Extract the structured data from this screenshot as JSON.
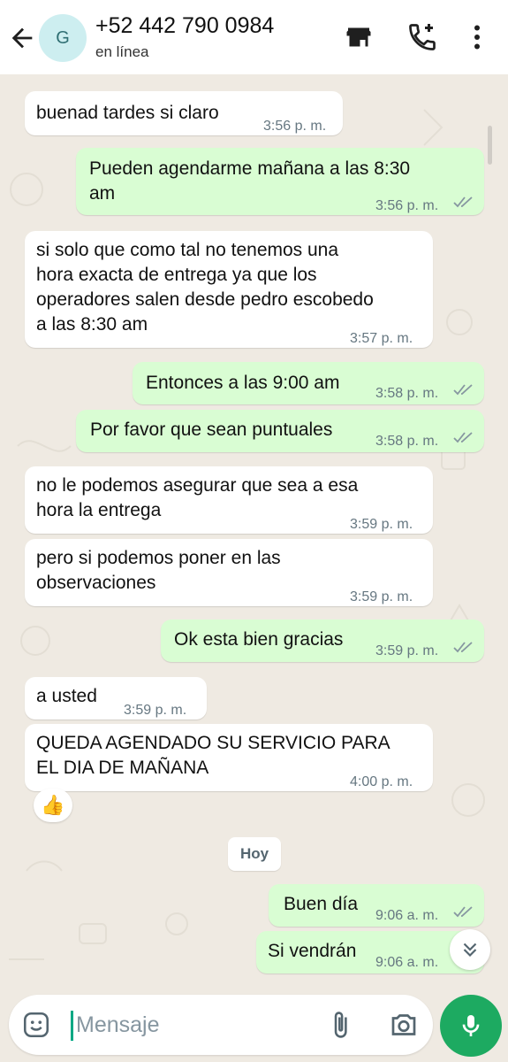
{
  "header": {
    "avatar_letter": "G",
    "title": "+52 442 790 0984",
    "subtitle": "en línea"
  },
  "icons": {
    "back": "arrow-left-icon",
    "store": "store-icon",
    "call": "add-call-icon",
    "menu": "more-vertical-icon",
    "emoji": "emoji-icon",
    "attach": "paperclip-icon",
    "camera": "camera-icon",
    "mic": "microphone-icon",
    "scroll": "chevron-double-down-icon"
  },
  "colors": {
    "background": "#efeae2",
    "incoming": "#ffffff",
    "outgoing": "#d9fdd3",
    "accent": "#1daa61",
    "tick": "#8696a0"
  },
  "messages": [
    {
      "dir": "in",
      "text": "buenad tardes si claro",
      "time": "3:56 p. m."
    },
    {
      "dir": "out",
      "text": "Pueden agendarme mañana a las 8:30\nam",
      "time": "3:56 p. m."
    },
    {
      "dir": "in",
      "text": "si solo que como tal no tenemos una\nhora exacta de entrega ya que los\noperadores salen desde pedro escobedo\na las 8:30 am",
      "time": "3:57 p. m."
    },
    {
      "dir": "out",
      "text": "Entonces a las 9:00 am",
      "time": "3:58 p. m."
    },
    {
      "dir": "out",
      "text": "Por favor que sean puntuales",
      "time": "3:58 p. m."
    },
    {
      "dir": "in",
      "text": "no le podemos asegurar que sea a esa\nhora la entrega",
      "time": "3:59 p. m."
    },
    {
      "dir": "in",
      "text": "pero si podemos poner en las\nobservaciones",
      "time": "3:59 p. m."
    },
    {
      "dir": "out",
      "text": "Ok esta bien gracias",
      "time": "3:59 p. m."
    },
    {
      "dir": "in",
      "text": "a usted",
      "time": "3:59 p. m."
    },
    {
      "dir": "in",
      "text": "QUEDA AGENDADO SU SERVICIO PARA\nEL DIA DE MAÑANA",
      "time": "4:00 p. m.",
      "reaction": "👍"
    },
    {
      "dir": "out",
      "text": "Buen día",
      "time": "9:06 a. m."
    },
    {
      "dir": "out",
      "text": "Si vendrán",
      "time": "9:06 a. m."
    }
  ],
  "date_divider": "Hoy",
  "composer": {
    "placeholder": "Mensaje"
  }
}
